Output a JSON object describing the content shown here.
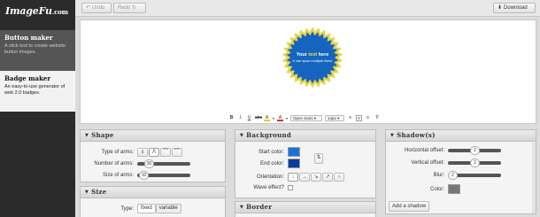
{
  "app": {
    "logo": "ImageFu",
    "logo_suffix": ".com"
  },
  "sidebar": {
    "items": [
      {
        "title": "Button maker",
        "desc": "A slick tool to create website button images."
      },
      {
        "title": "Badge maker",
        "desc": "An easy-to-use generator of web 2.0 badges."
      }
    ]
  },
  "toolbar": {
    "undo_label": "Undo",
    "redo_label": "Redo",
    "download_label": "Download"
  },
  "canvas": {
    "badge_line1_a": "Your ",
    "badge_line1_b": "text",
    "badge_line1_c": " here",
    "badge_line2": "It can span multiple lines!",
    "font_select": "Open Sans",
    "size_select": "14px",
    "badge_color": "#1565c0",
    "badge_border": "#e4d44a"
  },
  "shape": {
    "title": "Shape",
    "type_label": "Type of arms:",
    "arms_label": "Number of arms:",
    "arms_value": "30",
    "size_label": "Size of arms:",
    "size_value": "10"
  },
  "size_panel": {
    "title": "Size",
    "type_label": "Type:",
    "fixed_label": "fixed",
    "variable_label": "variable"
  },
  "background": {
    "title": "Background",
    "start_label": "Start color:",
    "start_color": "#1e6fd9",
    "end_label": "End color:",
    "end_color": "#0b3d9e",
    "orientation_label": "Orientation:",
    "wave_label": "Wave effect?"
  },
  "border": {
    "title": "Border"
  },
  "shadows": {
    "title": "Shadow(s)",
    "h_label": "Horizontal offset:",
    "h_value": "2",
    "v_label": "Vertical offset:",
    "v_value": "2",
    "blur_label": "Blur:",
    "blur_value": "2",
    "color_label": "Color:",
    "color_value": "#777777",
    "add_label": "Add a shadow"
  }
}
